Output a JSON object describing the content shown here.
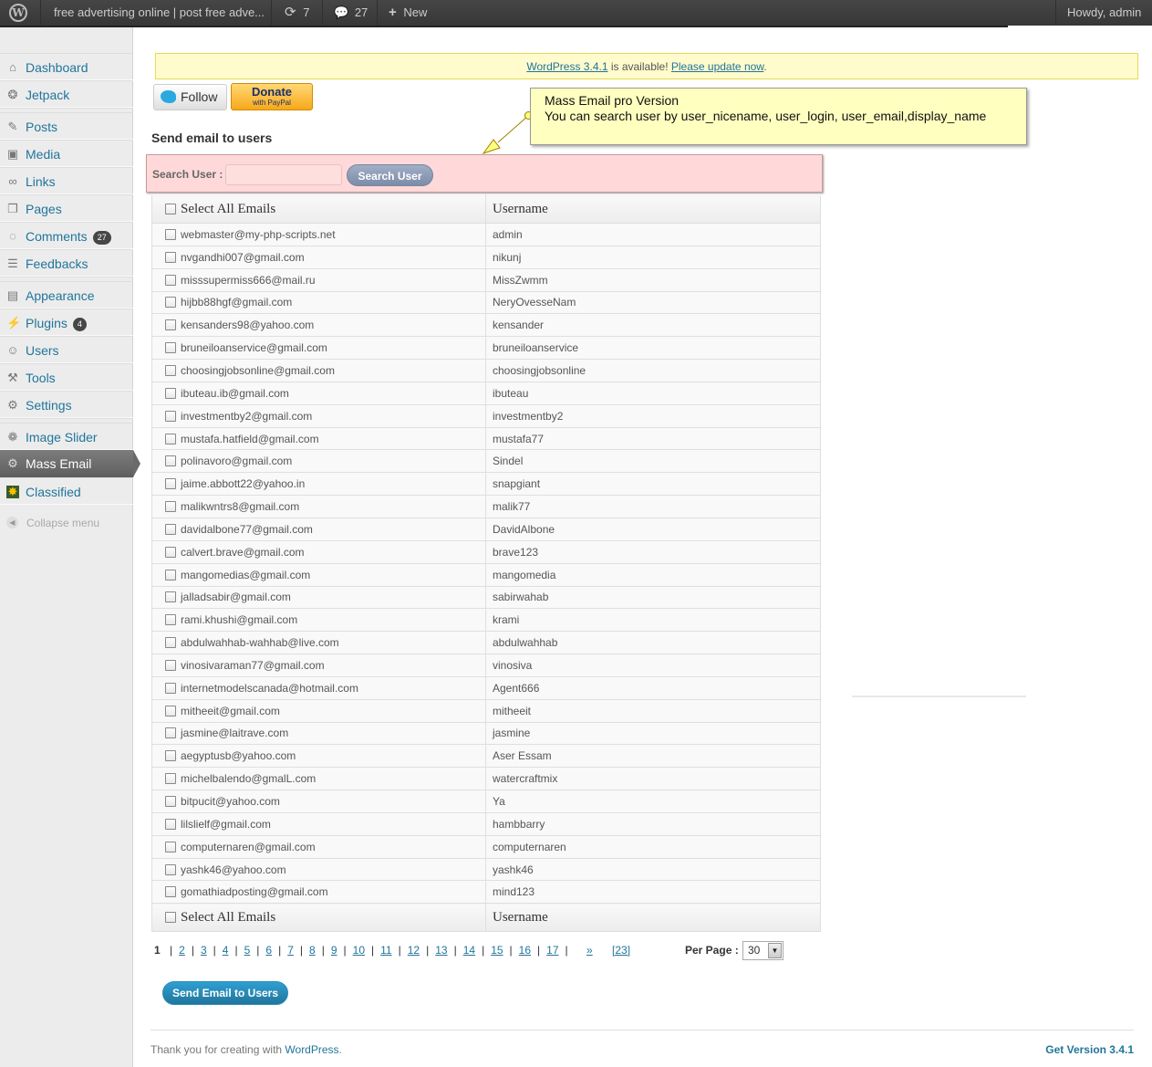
{
  "adminbar": {
    "site_title": "free advertising online | post free adve...",
    "updates_count": "7",
    "comments_count": "27",
    "new_label": "New",
    "howdy": "Howdy, admin"
  },
  "sidebar": {
    "items": [
      {
        "label": "Dashboard",
        "icon": "dashboard-icon"
      },
      {
        "label": "Jetpack",
        "icon": "jetpack-icon"
      },
      {
        "label": "Posts",
        "icon": "posts-icon"
      },
      {
        "label": "Media",
        "icon": "media-icon"
      },
      {
        "label": "Links",
        "icon": "links-icon"
      },
      {
        "label": "Pages",
        "icon": "pages-icon"
      },
      {
        "label": "Comments",
        "icon": "comments-icon",
        "badge": "27"
      },
      {
        "label": "Feedbacks",
        "icon": "feedbacks-icon"
      },
      {
        "label": "Appearance",
        "icon": "appearance-icon"
      },
      {
        "label": "Plugins",
        "icon": "plugins-icon",
        "badge": "4"
      },
      {
        "label": "Users",
        "icon": "users-icon"
      },
      {
        "label": "Tools",
        "icon": "tools-icon"
      },
      {
        "label": "Settings",
        "icon": "settings-icon"
      },
      {
        "label": "Image Slider",
        "icon": "image-slider-icon"
      },
      {
        "label": "Mass Email",
        "icon": "gear-icon",
        "current": true
      },
      {
        "label": "Classified",
        "icon": "classified-icon"
      }
    ],
    "collapse_label": "Collapse menu"
  },
  "notice": {
    "link1": "WordPress 3.4.1",
    "middle": " is available! ",
    "link2": "Please update now",
    "end": "."
  },
  "social": {
    "follow_label": "Follow",
    "donate_label": "Donate",
    "donate_sub": "with PayPal"
  },
  "tooltip": {
    "line1": "Mass Email pro Version",
    "line2": "You can search user by user_nicename, user_login, user_email,display_name"
  },
  "page_title": "Send email to users",
  "search": {
    "label": "Search User :",
    "value": "",
    "button": "Search User"
  },
  "table": {
    "header_email": "Select All Emails",
    "header_username": "Username",
    "rows": [
      {
        "email": "webmaster@my-php-scripts.net",
        "username": "admin"
      },
      {
        "email": "nvgandhi007@gmail.com",
        "username": "nikunj"
      },
      {
        "email": "misssupermiss666@mail.ru",
        "username": "MissZwmm"
      },
      {
        "email": "hijbb88hgf@gmail.com",
        "username": "NeryOvesseNam"
      },
      {
        "email": "kensanders98@yahoo.com",
        "username": "kensander"
      },
      {
        "email": "bruneiloanservice@gmail.com",
        "username": "bruneiloanservice"
      },
      {
        "email": "choosingjobsonline@gmail.com",
        "username": "choosingjobsonline"
      },
      {
        "email": "ibuteau.ib@gmail.com",
        "username": "ibuteau"
      },
      {
        "email": "investmentby2@gmail.com",
        "username": "investmentby2"
      },
      {
        "email": "mustafa.hatfield@gmail.com",
        "username": "mustafa77"
      },
      {
        "email": "polinavoro@gmail.com",
        "username": "Sindel"
      },
      {
        "email": "jaime.abbott22@yahoo.in",
        "username": "snapgiant"
      },
      {
        "email": "malikwntrs8@gmail.com",
        "username": "malik77"
      },
      {
        "email": "davidalbone77@gmail.com",
        "username": "DavidAlbone"
      },
      {
        "email": "calvert.brave@gmail.com",
        "username": "brave123"
      },
      {
        "email": "mangomedias@gmail.com",
        "username": "mangomedia"
      },
      {
        "email": "jalladsabir@gmail.com",
        "username": "sabirwahab"
      },
      {
        "email": "rami.khushi@gmail.com",
        "username": "krami"
      },
      {
        "email": "abdulwahhab-wahhab@live.com",
        "username": "abdulwahhab"
      },
      {
        "email": "vinosivaraman77@gmail.com",
        "username": "vinosiva"
      },
      {
        "email": "internetmodelscanada@hotmail.com",
        "username": "Agent666"
      },
      {
        "email": "mitheeit@gmail.com",
        "username": "mitheeit"
      },
      {
        "email": "jasmine@laitrave.com",
        "username": "jasmine"
      },
      {
        "email": "aegyptusb@yahoo.com",
        "username": "Aser Essam"
      },
      {
        "email": "michelbalendo@gmalL.com",
        "username": "watercraftmix"
      },
      {
        "email": "bitpucit@yahoo.com",
        "username": "Ya"
      },
      {
        "email": "lilslielf@gmail.com",
        "username": "hambbarry"
      },
      {
        "email": "computernaren@gmail.com",
        "username": "computernaren"
      },
      {
        "email": "yashk46@yahoo.com",
        "username": "yashk46"
      },
      {
        "email": "gomathiadposting@gmail.com",
        "username": "mind123"
      }
    ]
  },
  "pagination": {
    "current": "1",
    "pages": [
      "2",
      "3",
      "4",
      "5",
      "6",
      "7",
      "8",
      "9",
      "10",
      "11",
      "12",
      "13",
      "14",
      "15",
      "16",
      "17"
    ],
    "next": "»",
    "last": "[23]",
    "per_page_label": "Per Page :",
    "per_page_value": "30"
  },
  "send_button": "Send Email to Users",
  "footer": {
    "text": "Thank you for creating with ",
    "link": "WordPress",
    "end": ".",
    "version": "Get Version 3.4.1"
  }
}
